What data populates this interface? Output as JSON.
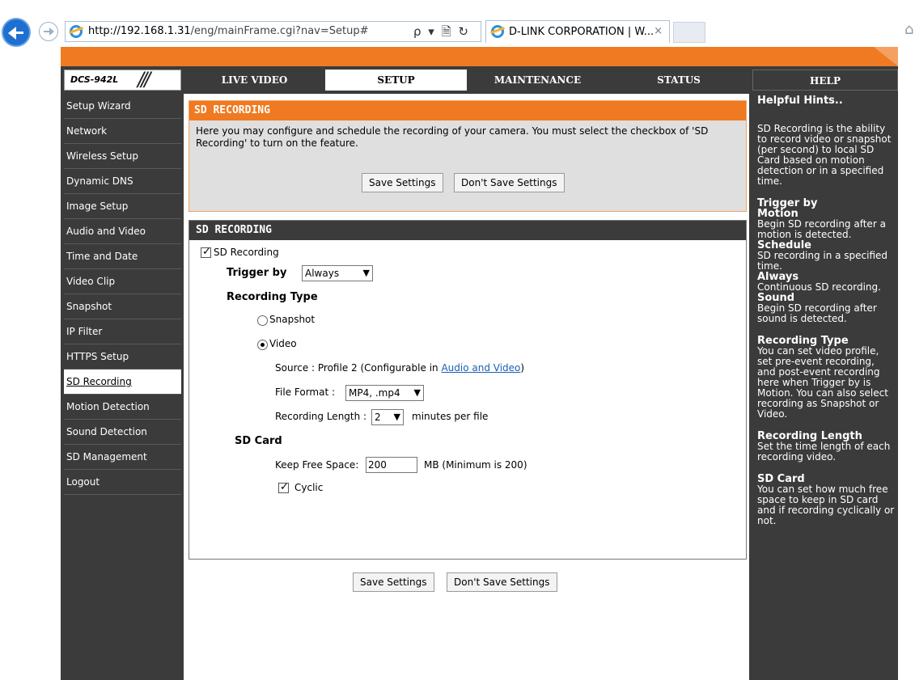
{
  "browser": {
    "url_host": "http://192.168.1.31",
    "url_path": "/eng/mainFrame.cgi?nav=Setup#",
    "addr_tools": "ρ ▾ 🗎 ↻",
    "tab_title": "D-LINK CORPORATION | W...",
    "tab_close": "×"
  },
  "header": {
    "logo": "DCS-942L",
    "logo_slashes": "///",
    "tabs": [
      "LIVE VIDEO",
      "SETUP",
      "MAINTENANCE",
      "STATUS"
    ],
    "help_tab": "HELP"
  },
  "sidebar": {
    "items": [
      {
        "label": "Setup Wizard"
      },
      {
        "label": "Network"
      },
      {
        "label": "Wireless Setup"
      },
      {
        "label": "Dynamic DNS"
      },
      {
        "label": "Image Setup"
      },
      {
        "label": "Audio and Video"
      },
      {
        "label": "Time and Date"
      },
      {
        "label": "Video Clip"
      },
      {
        "label": "Snapshot"
      },
      {
        "label": "IP Filter"
      },
      {
        "label": "HTTPS Setup"
      },
      {
        "label": "SD Recording"
      },
      {
        "label": "Motion Detection"
      },
      {
        "label": "Sound Detection"
      },
      {
        "label": "SD Management"
      },
      {
        "label": "Logout"
      }
    ],
    "active_index": 11
  },
  "intro_panel": {
    "title": "SD RECORDING",
    "text": "Here you may configure and schedule the recording of your camera. You must select the checkbox of 'SD Recording' to turn on the feature.",
    "save_label": "Save Settings",
    "dont_save_label": "Don't Save Settings"
  },
  "settings_panel": {
    "title": "SD RECORDING",
    "sd_recording_label": "SD Recording",
    "sd_recording_checked": true,
    "trigger_label": "Trigger by",
    "trigger_value": "Always",
    "recording_type_label": "Recording Type",
    "snapshot_label": "Snapshot",
    "video_label": "Video",
    "selected_type": "Video",
    "source_prefix": "Source : Profile 2  (Configurable in ",
    "source_link": "Audio and Video",
    "source_suffix": ")",
    "file_format_label": "File Format :",
    "file_format_value": "MP4, .mp4",
    "recording_length_label": "Recording Length :",
    "recording_length_value": "2",
    "recording_length_unit": "minutes per file",
    "sd_card_label": "SD Card",
    "keep_free_label": "Keep Free Space:",
    "keep_free_value": "200",
    "keep_free_unit": "MB (Minimum is 200)",
    "cyclic_label": "Cyclic",
    "cyclic_checked": true
  },
  "bottom_buttons": {
    "save_label": "Save Settings",
    "dont_save_label": "Don't Save Settings"
  },
  "help": {
    "title": "Helpful Hints..",
    "intro": "SD Recording is the ability to record video or snapshot (per second) to local SD Card based on motion detection or in a specified time.",
    "trigger_heading": "Trigger by",
    "motion_heading": "Motion",
    "motion_text": "Begin SD recording after a motion is detected.",
    "schedule_heading": "Schedule",
    "schedule_text": "SD recording in a specified time.",
    "always_heading": "Always",
    "always_text": "Continuous SD recording.",
    "sound_heading": "Sound",
    "sound_text": "Begin SD recording after sound is detected.",
    "rectype_heading": "Recording Type",
    "rectype_text": "You can set video profile, set pre-event recording, and post-event recording here when Trigger by is Motion. You can also select recording as Snapshot or Video.",
    "reclen_heading": "Recording Length",
    "reclen_text": "Set the time length of each recording video.",
    "sdcard_heading": "SD Card",
    "sdcard_text": "You can set how much free space to keep in SD card and if recording cyclically or not."
  },
  "colors": {
    "accent": "#ef7a21",
    "dark": "#3b3b3b",
    "link": "#1a5fb4"
  }
}
